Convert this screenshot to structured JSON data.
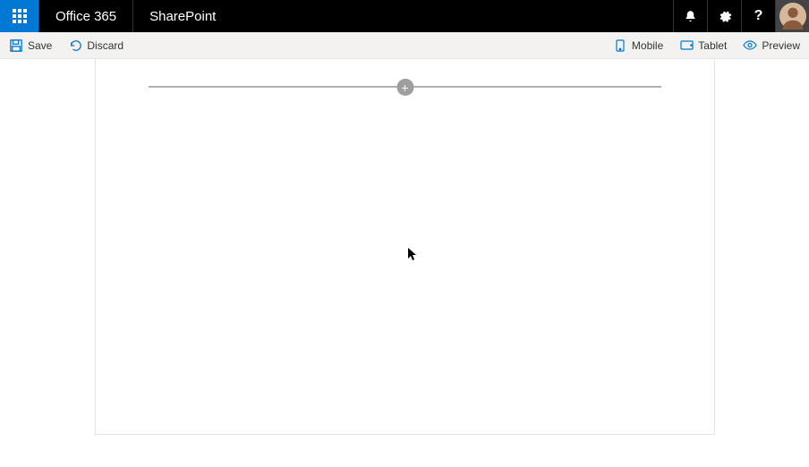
{
  "header": {
    "brand": "Office 365",
    "app": "SharePoint",
    "icons": {
      "launcher": "app-launcher",
      "notifications": "notifications",
      "settings": "settings",
      "help": "help",
      "avatar": "user-avatar"
    }
  },
  "actionbar": {
    "save_label": "Save",
    "discard_label": "Discard",
    "mobile_label": "Mobile",
    "tablet_label": "Tablet",
    "preview_label": "Preview"
  },
  "canvas": {
    "add_label": "+"
  }
}
